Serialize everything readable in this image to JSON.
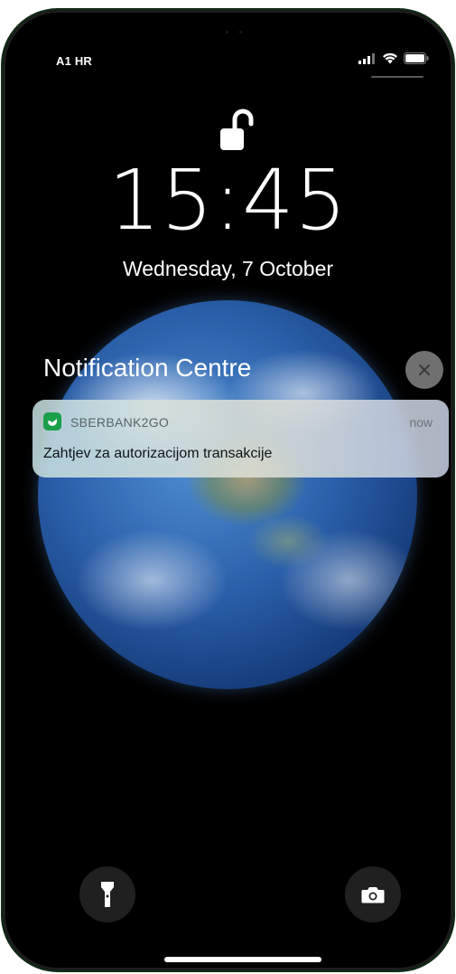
{
  "status_bar": {
    "carrier": "A1 HR",
    "icons": [
      "cellular-signal-icon",
      "wifi-icon",
      "battery-icon"
    ]
  },
  "lock_screen": {
    "lock_state_icon": "unlocked-padlock-icon",
    "time": "15:45",
    "date": "Wednesday, 7 October"
  },
  "notification_centre": {
    "title": "Notification Centre",
    "clear_icon": "close-icon"
  },
  "notification": {
    "app_name": "SBERBANK2GO",
    "time": "now",
    "body": "Zahtjev za autorizacijom transakcije",
    "app_icon": "sberbank-app-icon",
    "app_icon_color": "#1a9f4a"
  },
  "quick_actions": {
    "left_icon": "flashlight-icon",
    "right_icon": "camera-icon"
  },
  "colors": {
    "background": "#000000",
    "text": "#ffffff"
  }
}
